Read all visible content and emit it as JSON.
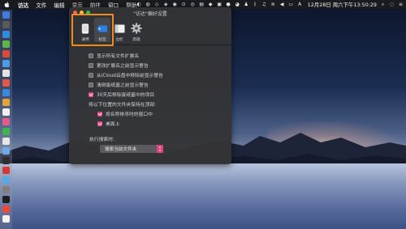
{
  "menubar": {
    "app_name": "访达",
    "items": [
      "文件",
      "编辑",
      "显示",
      "前往",
      "窗口",
      "帮助"
    ],
    "clock": "12月28日 周六下午13:50:29"
  },
  "window": {
    "title": "\"访达\"偏好设置",
    "tabs": [
      {
        "label": "通用",
        "icon": "phone-general-icon"
      },
      {
        "label": "标签",
        "icon": "tag-icon"
      },
      {
        "label": "边栏",
        "icon": "sidebar-icon"
      },
      {
        "label": "高级",
        "icon": "gear-icon"
      }
    ],
    "options": [
      {
        "label": "显示所有文件扩展名",
        "checked": false
      },
      {
        "label": "更改扩展名之前显示警告",
        "checked": false
      },
      {
        "label": "从iCloud云盘中移除前显示警告",
        "checked": false
      },
      {
        "label": "清倒废纸篓之前显示警告",
        "checked": false
      },
      {
        "label": "30天后移除废纸篓中的项目",
        "checked": true
      }
    ],
    "keep_top_label": "将以下位置的文件夹保持在顶部:",
    "keep_top_options": [
      {
        "label": "按名称排序时的窗口中",
        "checked": true
      },
      {
        "label": "桌面上",
        "checked": true
      }
    ],
    "search_label": "执行搜索时:",
    "search_select": "搜索当前文件夹"
  },
  "colors": {
    "accent": "#e0457b",
    "highlight": "#f08a1c"
  }
}
